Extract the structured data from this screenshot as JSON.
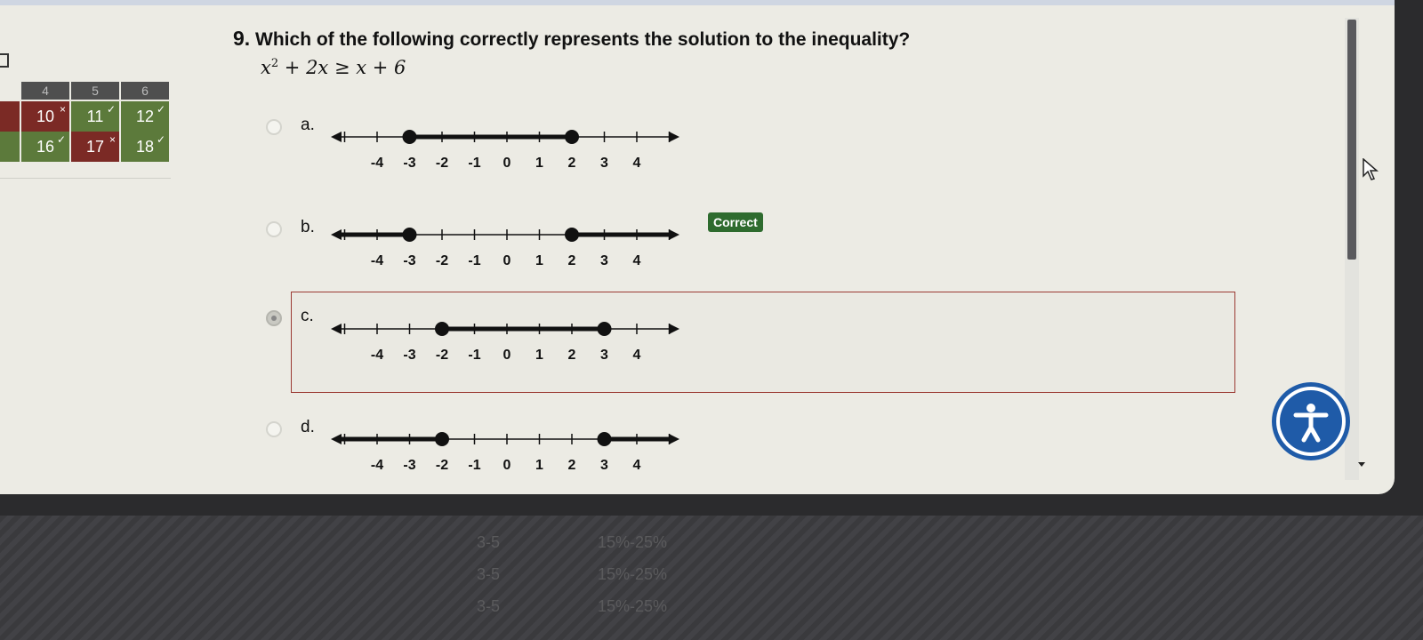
{
  "question": {
    "number": "9.",
    "text": "Which of the following correctly represents the solution to the inequality?",
    "equation_lhs": "x",
    "equation_exp": "2",
    "equation_rest": " + 2x ≥ x + 6"
  },
  "grid": {
    "header": [
      "4",
      "5",
      "6"
    ],
    "rows": [
      {
        "cells": [
          {
            "label": "10",
            "status": "wrong"
          },
          {
            "label": "11",
            "status": "correct"
          },
          {
            "label": "12",
            "status": "correct"
          }
        ]
      },
      {
        "cells": [
          {
            "label": "16",
            "status": "correct"
          },
          {
            "label": "17",
            "status": "wrong"
          },
          {
            "label": "18",
            "status": "correct"
          }
        ]
      }
    ],
    "marks": {
      "correct": "✓",
      "wrong": "×"
    }
  },
  "options": [
    {
      "id": "a",
      "label": "a.",
      "selected": false,
      "dots": [
        -3,
        2
      ],
      "segment": "between"
    },
    {
      "id": "b",
      "label": "b.",
      "selected": false,
      "dots": [
        -3,
        2
      ],
      "segment": "outside"
    },
    {
      "id": "c",
      "label": "c.",
      "selected": true,
      "dots": [
        -2,
        3
      ],
      "segment": "between"
    },
    {
      "id": "d",
      "label": "d.",
      "selected": false,
      "dots": [
        -2,
        3
      ],
      "segment": "outside"
    }
  ],
  "tick_labels": [
    "-4",
    "-3",
    "-2",
    "-1",
    "0",
    "1",
    "2",
    "3",
    "4"
  ],
  "correct_badge": "Correct",
  "bottom": {
    "col1": [
      "3-5",
      "3-5",
      "3-5"
    ],
    "col2": [
      "15%-25%",
      "15%-25%",
      "15%-25%"
    ]
  },
  "colors": {
    "accent": "#1f5ba8",
    "correct": "#2e6b2e",
    "selected_border": "#9b3a33"
  }
}
